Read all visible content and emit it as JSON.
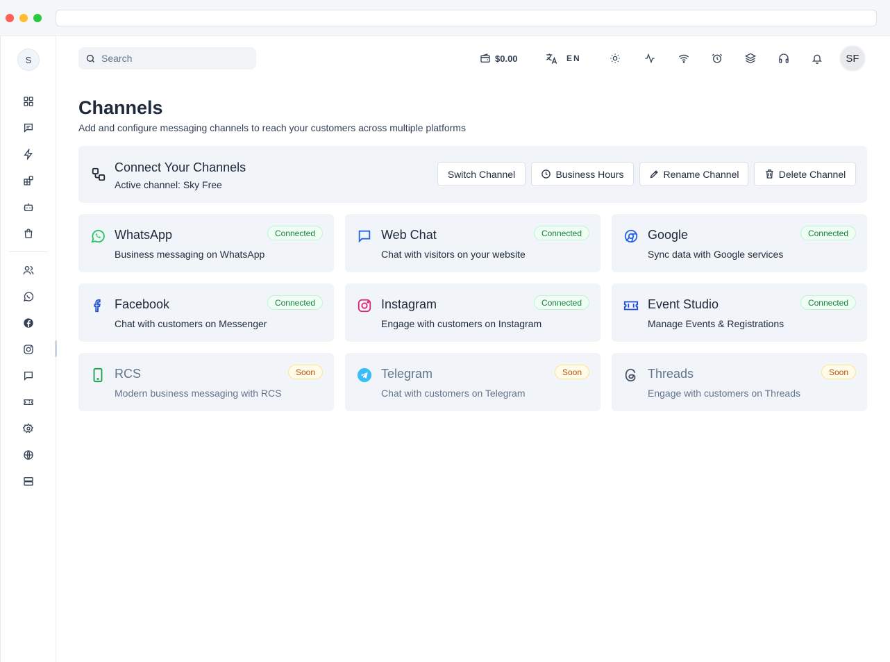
{
  "window": {
    "dots": [
      "close",
      "minimize",
      "maximize"
    ]
  },
  "sidebar": {
    "avatar_initial": "S",
    "items": [
      {
        "icon": "dashboard-icon"
      },
      {
        "icon": "chat-icon"
      },
      {
        "icon": "lightning-icon"
      },
      {
        "icon": "integrations-icon"
      },
      {
        "icon": "bot-icon"
      },
      {
        "icon": "shopping-bag-icon"
      },
      {
        "icon": "users-icon"
      },
      {
        "icon": "whatsapp-icon"
      },
      {
        "icon": "facebook-icon"
      },
      {
        "icon": "instagram-icon"
      },
      {
        "icon": "message-icon"
      },
      {
        "icon": "ticket-icon"
      },
      {
        "icon": "settings-icon"
      },
      {
        "icon": "globe-icon"
      },
      {
        "icon": "server-icon"
      }
    ]
  },
  "topbar": {
    "search_placeholder": "Search",
    "balance": "$0.00",
    "language": "EN",
    "avatar_initials": "SF"
  },
  "page": {
    "title": "Channels",
    "subtitle": "Add and configure messaging channels to reach your customers across multiple platforms"
  },
  "connect": {
    "title": "Connect Your Channels",
    "active_channel": "Active channel: Sky Free",
    "buttons": {
      "switch": "Switch Channel",
      "hours": "Business Hours",
      "rename": "Rename Channel",
      "delete": "Delete Channel"
    }
  },
  "channels": [
    {
      "title": "WhatsApp",
      "desc": "Business messaging on WhatsApp",
      "status": "Connected",
      "icon": "whatsapp-icon",
      "color": "#22c55e"
    },
    {
      "title": "Web Chat",
      "desc": "Chat with visitors on your website",
      "status": "Connected",
      "icon": "web-chat-icon",
      "color": "#2563eb"
    },
    {
      "title": "Google",
      "desc": "Sync data with Google services",
      "status": "Connected",
      "icon": "google-icon",
      "color": "#2563eb"
    },
    {
      "title": "Facebook",
      "desc": "Chat with customers on Messenger",
      "status": "Connected",
      "icon": "facebook-icon",
      "color": "#1d4ed8"
    },
    {
      "title": "Instagram",
      "desc": "Engage with customers on Instagram",
      "status": "Connected",
      "icon": "instagram-icon",
      "color": "#db2777"
    },
    {
      "title": "Event Studio",
      "desc": "Manage Events & Registrations",
      "status": "Connected",
      "icon": "ticket-icon",
      "color": "#1d4ed8"
    },
    {
      "title": "RCS",
      "desc": "Modern business messaging with RCS",
      "status": "Soon",
      "icon": "phone-icon",
      "color": "#16a34a"
    },
    {
      "title": "Telegram",
      "desc": "Chat with customers on Telegram",
      "status": "Soon",
      "icon": "telegram-icon",
      "color": "#38bdf8"
    },
    {
      "title": "Threads",
      "desc": "Engage with customers on Threads",
      "status": "Soon",
      "icon": "threads-icon",
      "color": "#475569"
    }
  ]
}
